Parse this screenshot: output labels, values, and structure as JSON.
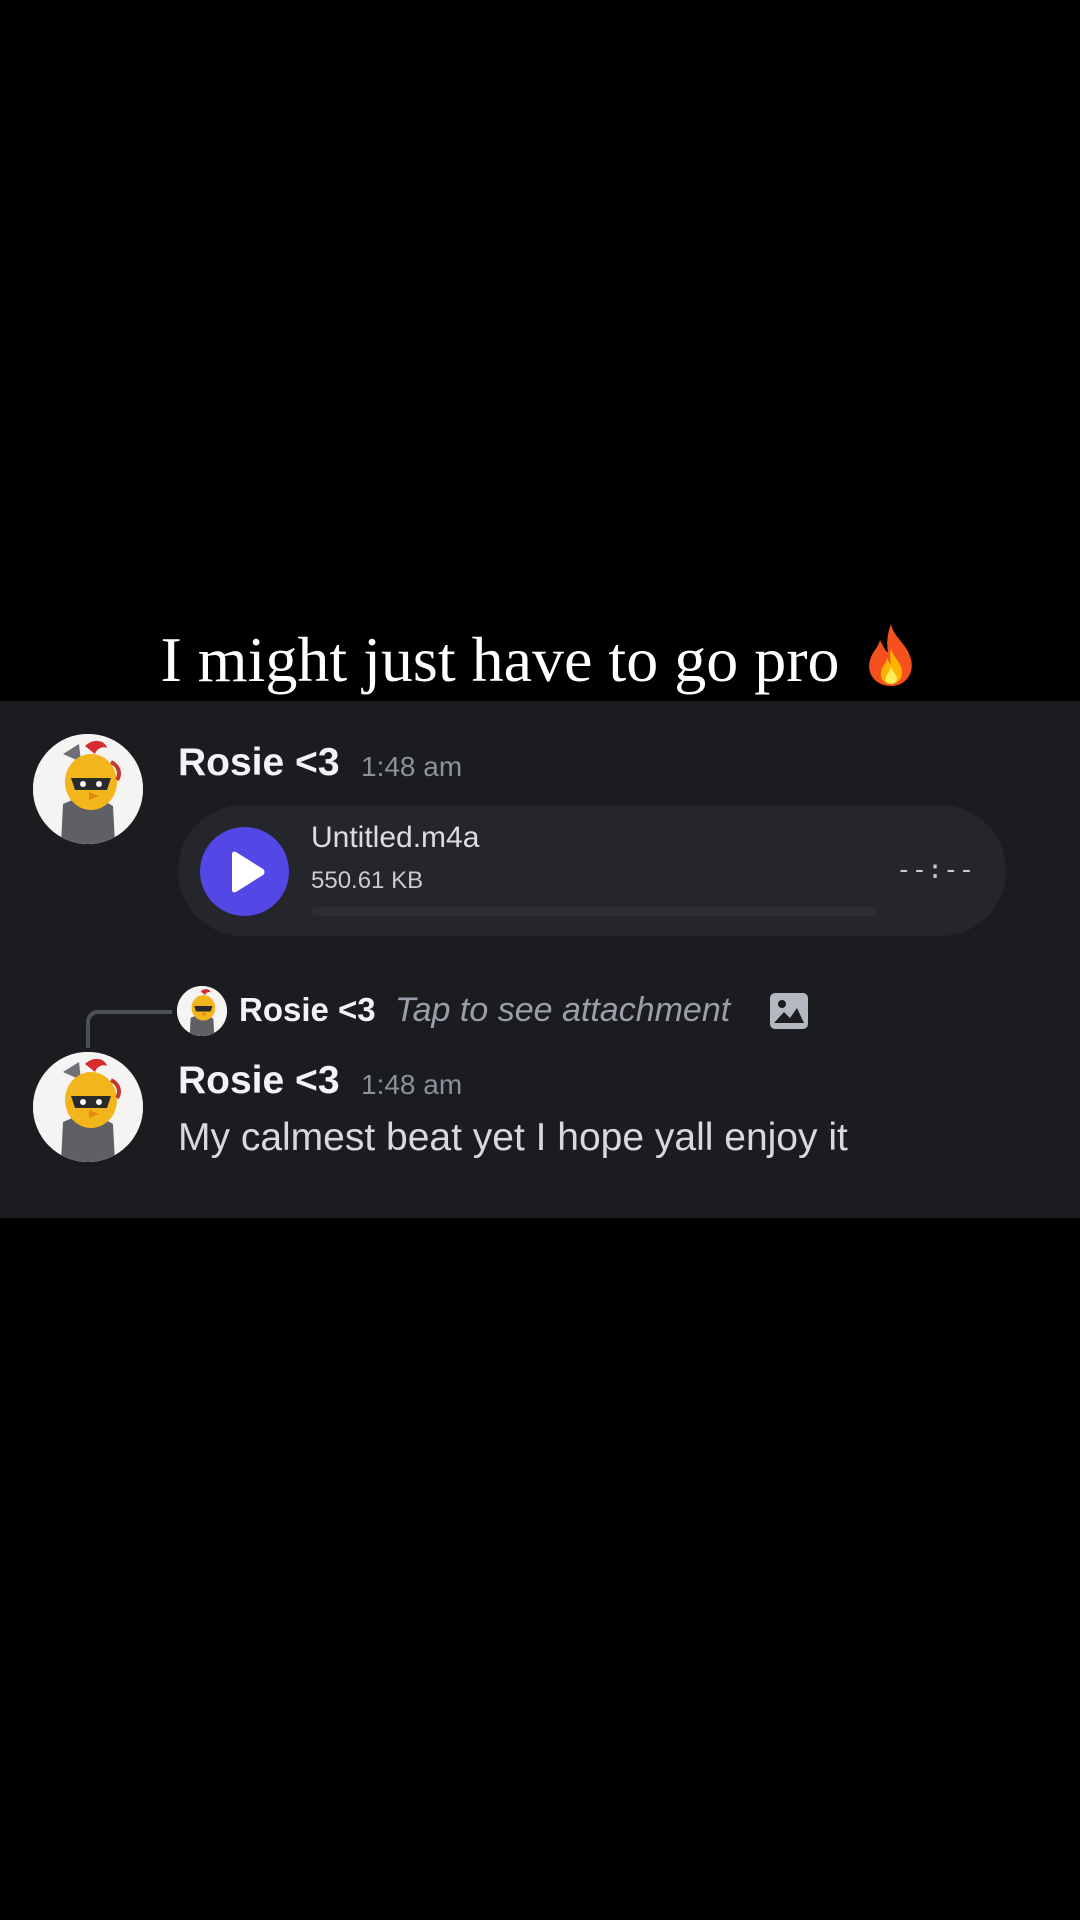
{
  "caption": {
    "text": "I might just have to go pro",
    "emoji_icon": "fire-icon"
  },
  "messages": [
    {
      "username": "Rosie <3",
      "timestamp": "1:48 am",
      "avatar_icon": "cartoon-bird-avatar",
      "attachment": {
        "file_name": "Untitled.m4a",
        "file_size": "550.61 KB",
        "duration": "--:--",
        "play_icon": "play-icon",
        "progress": 0
      }
    },
    {
      "reply": {
        "username": "Rosie <3",
        "text": "Tap to see attachment",
        "icon": "image-icon"
      },
      "username": "Rosie <3",
      "timestamp": "1:48 am",
      "avatar_icon": "cartoon-bird-avatar",
      "text": "My calmest beat yet I hope yall enjoy it"
    }
  ],
  "colors": {
    "background": "#000000",
    "panel": "#1b1c20",
    "attachment_bg": "#25262b",
    "play_button": "#5347e6"
  }
}
